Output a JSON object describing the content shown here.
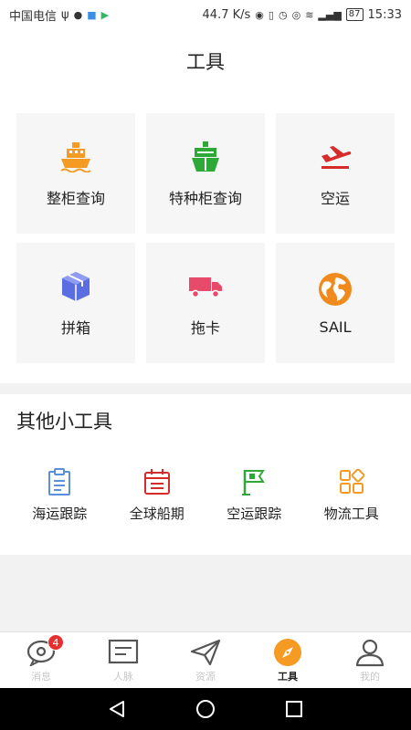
{
  "status_bar": {
    "carrier": "中国电信",
    "speed": "44.7 K/s",
    "battery": "87",
    "time": "15:33"
  },
  "header": {
    "title": "工具"
  },
  "main_tools": [
    {
      "label": "整柜查询",
      "icon": "ship-icon",
      "color": "#f59a23"
    },
    {
      "label": "特种柜查询",
      "icon": "cargo-ship-icon",
      "color": "#2ea836"
    },
    {
      "label": "空运",
      "icon": "airplane-takeoff-icon",
      "color": "#d62b2b"
    },
    {
      "label": "拼箱",
      "icon": "box-icon",
      "color": "#5b6ee1"
    },
    {
      "label": "拖卡",
      "icon": "truck-icon",
      "color": "#e84a6a"
    },
    {
      "label": "SAIL",
      "icon": "globe-icon",
      "color": "#f08a1c"
    }
  ],
  "other_tools": {
    "title": "其他小工具",
    "items": [
      {
        "label": "海运跟踪",
        "icon": "clipboard-icon",
        "color": "#5a8fe0"
      },
      {
        "label": "全球船期",
        "icon": "calendar-icon",
        "color": "#d62b2b"
      },
      {
        "label": "空运跟踪",
        "icon": "flag-icon",
        "color": "#2ea836"
      },
      {
        "label": "物流工具",
        "icon": "grid-apps-icon",
        "color": "#f59a23"
      }
    ]
  },
  "bottom_nav": {
    "items": [
      {
        "label": "消息",
        "icon": "message-icon",
        "badge": "4"
      },
      {
        "label": "人脉",
        "icon": "contacts-card-icon"
      },
      {
        "label": "资源",
        "icon": "paper-plane-icon"
      },
      {
        "label": "工具",
        "icon": "compass-icon",
        "active": true
      },
      {
        "label": "我的",
        "icon": "profile-icon"
      }
    ]
  },
  "colors": {
    "active_tab": "#f59a23",
    "badge": "#e63030"
  }
}
